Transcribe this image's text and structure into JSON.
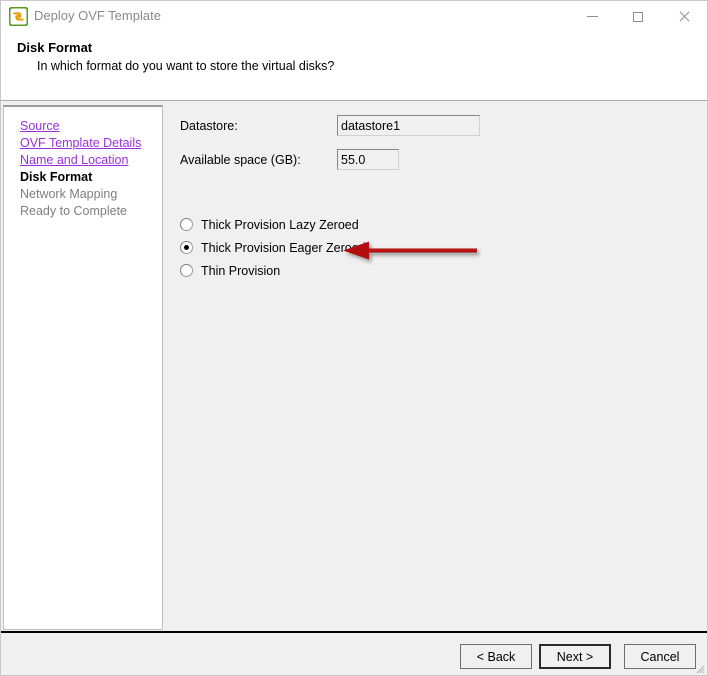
{
  "window": {
    "title": "Deploy OVF Template",
    "app_icon": "ovf-template-icon",
    "controls": {
      "minimize": "minimize-icon",
      "maximize": "maximize-icon",
      "close": "close-icon"
    }
  },
  "header": {
    "title": "Disk Format",
    "subtitle": "In which format do you want to store the virtual disks?"
  },
  "nav": {
    "items": [
      {
        "label": "Source",
        "state": "link"
      },
      {
        "label": "OVF Template Details",
        "state": "link"
      },
      {
        "label": "Name and Location",
        "state": "link"
      },
      {
        "label": "Disk Format",
        "state": "current"
      },
      {
        "label": "Network Mapping",
        "state": "pending"
      },
      {
        "label": "Ready to Complete",
        "state": "pending"
      }
    ]
  },
  "form": {
    "datastore": {
      "label": "Datastore:",
      "value": "datastore1"
    },
    "available_space": {
      "label": "Available space (GB):",
      "value": "55.0"
    }
  },
  "disk_format": {
    "options": [
      {
        "label": "Thick Provision Lazy Zeroed",
        "selected": false
      },
      {
        "label": "Thick Provision Eager Zeroed",
        "selected": true
      },
      {
        "label": "Thin Provision",
        "selected": false
      }
    ]
  },
  "annotation": {
    "arrow": "red-left-arrow",
    "points_to": "Thick Provision Eager Zeroed",
    "color": "#b41010"
  },
  "footer": {
    "back": "< Back",
    "next": "Next >",
    "cancel": "Cancel"
  },
  "colors": {
    "link": "#9b30d9",
    "background": "#f0f0f0",
    "arrow_red": "#b41010",
    "title_text": "#8a8a8a"
  }
}
